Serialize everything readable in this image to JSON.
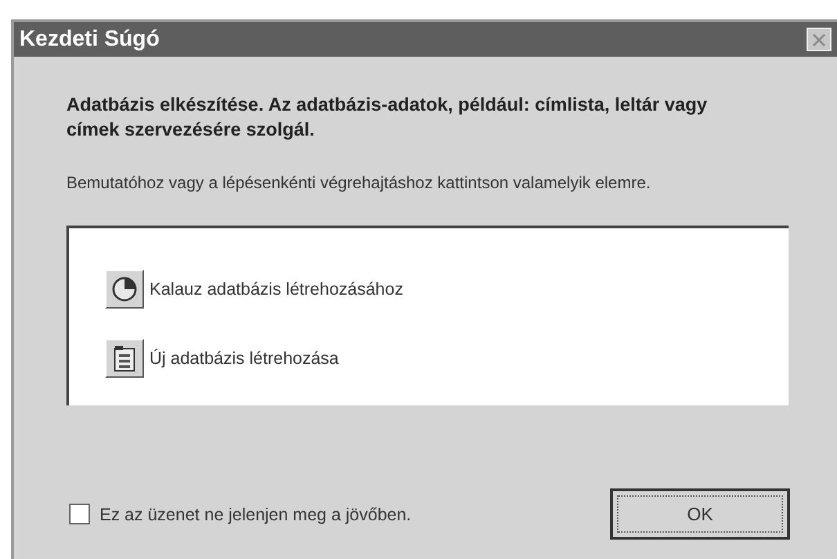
{
  "window": {
    "title": "Kezdeti Súgó"
  },
  "heading": "Adatbázis elkészítése. Az adatbázis-adatok, például: címlista, leltár vagy címek szervezésére szolgál.",
  "instruction": "Bemutatóhoz vagy a lépésenkénti végrehajtáshoz kattintson valamelyik elemre.",
  "options": [
    {
      "kind": "wizard",
      "label": "Kalauz adatbázis létrehozásához"
    },
    {
      "kind": "new",
      "label": "Új adatbázis létrehozása"
    }
  ],
  "checkbox": {
    "label": "Ez az üzenet ne jelenjen meg a jövőben.",
    "checked": false
  },
  "buttons": [
    "OK"
  ]
}
